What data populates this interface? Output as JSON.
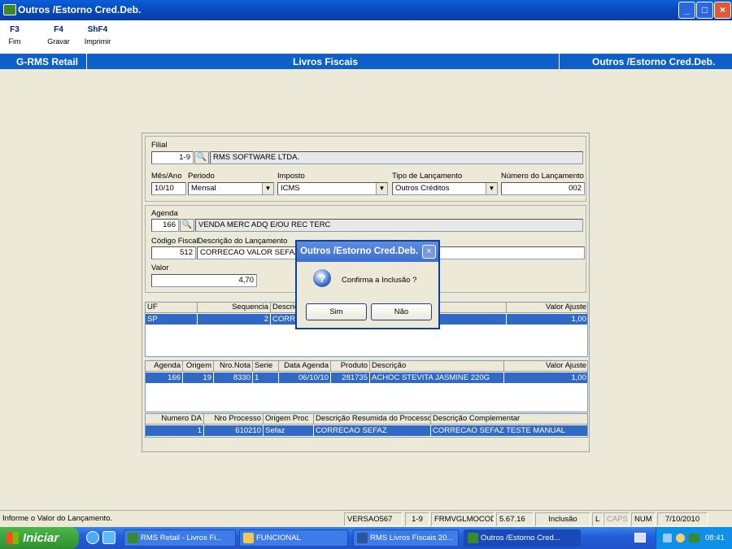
{
  "window": {
    "title": "Outros /Estorno Cred.Deb.",
    "controls": [
      "_",
      "□",
      "×"
    ]
  },
  "toolbar": [
    {
      "key": "F3",
      "label": "Fim"
    },
    {
      "key": "F4",
      "label": "Gravar"
    },
    {
      "key": "ShF4",
      "label": "Imprimir"
    }
  ],
  "header": {
    "left": "G-RMS Retail",
    "center": "Livros Fiscais",
    "right": "Outros /Estorno Cred.Deb."
  },
  "form": {
    "filial_label": "Filial",
    "filial_code": "1-9",
    "filial_name": "RMS SOFTWARE LTDA.",
    "mesano_label": "Mês/Ano",
    "mesano_value": "10/10",
    "periodo_label": "Periodo",
    "periodo_value": "Mensal",
    "imposto_label": "Imposto",
    "imposto_value": "ICMS",
    "tipo_label": "Tipo de Lançamento",
    "tipo_value": "Outros Créditos",
    "numero_label": "Número do Lançamento",
    "numero_value": "002",
    "agenda_label": "Agenda",
    "agenda_code": "166",
    "agenda_desc": "VENDA MERC ADQ E/OU REC TERC",
    "codfiscal_label": "Código Fiscal",
    "codfiscal_value": "512",
    "desclanc_label": "Descrição do Lançamento",
    "desclanc_value": "CORRECAO VALOR SEFAZ",
    "valor_label": "Valor",
    "valor_value": "4,70"
  },
  "grid1": {
    "headers": [
      "UF",
      "Sequencia",
      "Descriç",
      "Valor Ajuste"
    ],
    "row": [
      "SP",
      "2",
      "CORRE",
      "1,00"
    ]
  },
  "grid2": {
    "headers": [
      "Agenda",
      "Origem",
      "Nro.Nota",
      "Serie",
      "Data Agenda",
      "Produto",
      "Descrição",
      "Valor Ajuste"
    ],
    "row": [
      "166",
      "19",
      "8330",
      "1",
      "06/10/10",
      "281735",
      "ACHOC STEVITA JASMINE 220G",
      "1,00"
    ]
  },
  "grid3": {
    "headers": [
      "Numero DA",
      "Nro Processo",
      "Origem Proc",
      "Descrição Resumida do Processo",
      "Descrição Complementar"
    ],
    "row": [
      "1",
      "610210",
      "Sefaz",
      "CORRECAO SEFAZ",
      "CORRECAO SEFAZ TESTE MANUAL"
    ]
  },
  "dialog": {
    "title": "Outros /Estorno Cred.Deb.",
    "message": "Confirma a Inclusão ?",
    "yes": "Sim",
    "no": "Não",
    "icon": "question-icon"
  },
  "statusbar": {
    "hint": "Informe o Valor do Lançamento.",
    "version": "VERSAO567",
    "filial": "1-9",
    "form": "FRMVGLMOCOD",
    "build": "5.67.16",
    "mode": "Inclusão",
    "l": "L",
    "caps": "CAPS",
    "num": "NUM",
    "date": "7/10/2010"
  },
  "taskbar": {
    "start": "Iniciar",
    "tasks": [
      "RMS Retail - Livros Fi...",
      "FUNCIONAL",
      "RMS Livros Fiscais 20...",
      "Outros /Estorno Cred..."
    ],
    "time": "08:41"
  },
  "colors": {
    "header": "#0f5fc9",
    "selection": "#3169c6",
    "title": "#0846b8"
  }
}
